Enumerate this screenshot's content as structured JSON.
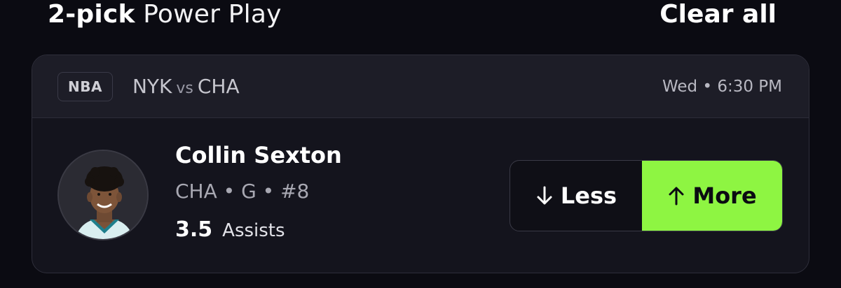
{
  "header": {
    "pick_count": "2-pick",
    "play_type": "Power Play",
    "clear_all": "Clear all"
  },
  "card": {
    "league": "NBA",
    "home_team": "NYK",
    "vs": "vs",
    "away_team": "CHA",
    "game_time": "Wed • 6:30 PM"
  },
  "player": {
    "name": "Collin Sexton",
    "meta": "CHA • G • #8",
    "line_value": "3.5",
    "line_stat": "Assists",
    "avatar_icon": "player-headshot"
  },
  "pick": {
    "less_label": "Less",
    "more_label": "More",
    "less_icon": "arrow-down-icon",
    "more_icon": "arrow-up-icon",
    "selected": "More",
    "accent_color": "#8ef542"
  }
}
